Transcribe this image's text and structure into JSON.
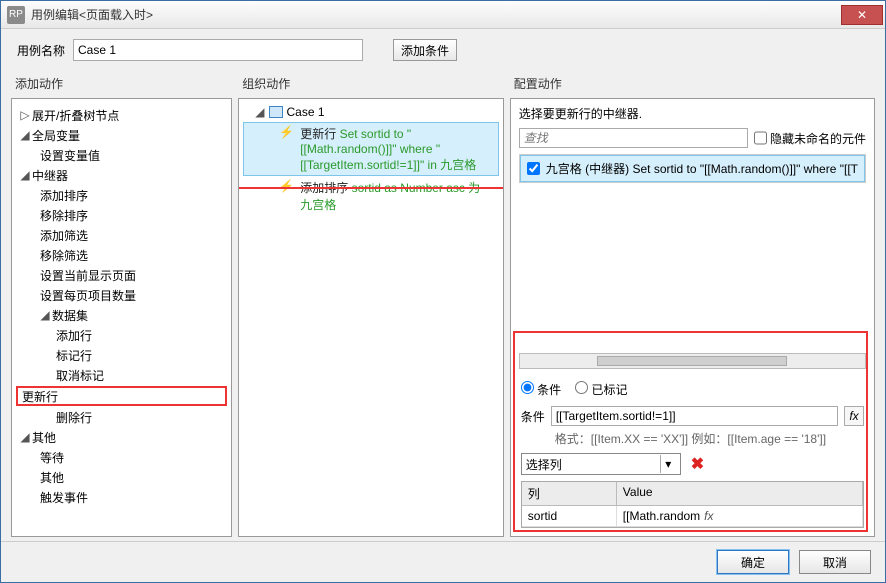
{
  "window": {
    "title": "用例编辑<页面载入时>"
  },
  "name": {
    "label": "用例名称",
    "value": "Case 1"
  },
  "buttons": {
    "addCondition": "添加条件",
    "ok": "确定",
    "cancel": "取消"
  },
  "cols": {
    "add": "添加动作",
    "org": "组织动作",
    "cfg": "配置动作"
  },
  "tree": {
    "n0": "展开/折叠树节点",
    "n1": "全局变量",
    "n1a": "设置变量值",
    "n2": "中继器",
    "n2a": "添加排序",
    "n2b": "移除排序",
    "n2c": "添加筛选",
    "n2d": "移除筛选",
    "n2e": "设置当前显示页面",
    "n2f": "设置每页项目数量",
    "n3": "数据集",
    "n3a": "添加行",
    "n3b": "标记行",
    "n3c": "取消标记",
    "n3d": "更新行",
    "n3e": "删除行",
    "n4": "其他",
    "n4a": "等待",
    "n4b": "其他",
    "n4c": "触发事件"
  },
  "org": {
    "case": "Case 1",
    "a1_black": "更新行 ",
    "a1_green": "Set sortid to \"[[Math.random()]]\" where \"[[TargetItem.sortid!=1]]\" in 九宫格",
    "a2_black": "添加排序 ",
    "a2_green": "sortid as Number asc 为 九宫格"
  },
  "cfg": {
    "topmsg": "选择要更新行的中继器.",
    "searchPlaceholder": "查找",
    "hideUnnamed": "隐藏未命名的元件",
    "item_black": "九宫格 (中继器) Set ",
    "item_green": "sortid to \"[[Math.random()]]\" where \"[[T",
    "radioCond": "条件",
    "radioMarked": "已标记",
    "condLabel": "条件",
    "condValue": "[[TargetItem.sortid!=1]]",
    "fmt": "格式：[[Item.XX == 'XX']] 例如：[[Item.age == '18']]",
    "selectCol": "选择列",
    "th1": "列",
    "th2": "Value",
    "td1": "sortid",
    "td2": "[[Math.random",
    "fx": "fx"
  }
}
